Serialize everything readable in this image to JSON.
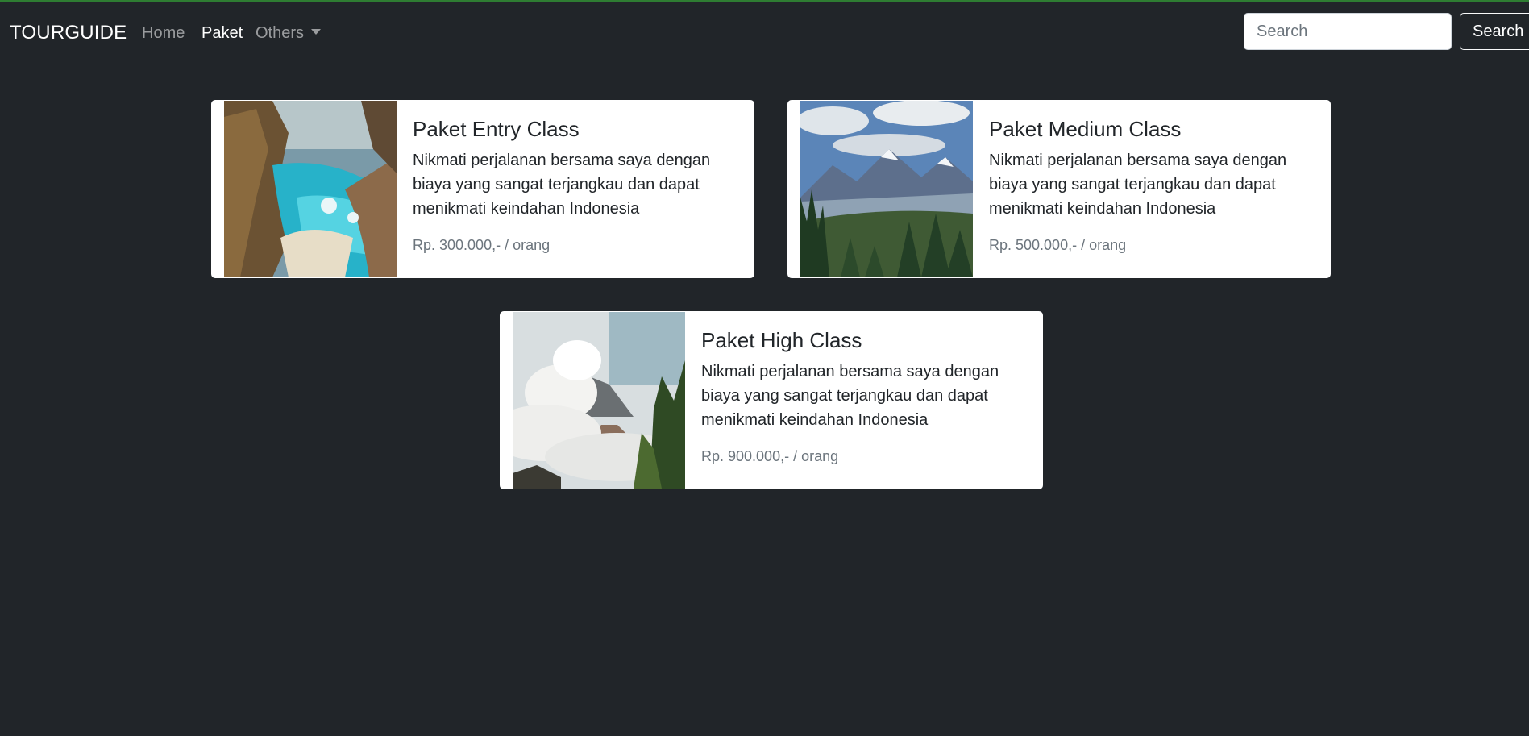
{
  "navbar": {
    "brand": "TOURGUIDE",
    "links": [
      {
        "label": "Home",
        "active": false
      },
      {
        "label": "Paket",
        "active": true
      },
      {
        "label": "Others",
        "active": false,
        "dropdown": true
      }
    ],
    "search": {
      "placeholder": "Search",
      "value": "",
      "button_label": "Search"
    }
  },
  "cards": [
    {
      "title": "Paket Entry Class",
      "description": "Nikmati perjalanan bersama saya dengan biaya yang sangat terjangkau dan dapat menikmati keindahan Indonesia",
      "price": "Rp. 300.000,- / orang",
      "image": "coastal-waterfall-landscape"
    },
    {
      "title": "Paket Medium Class",
      "description": "Nikmati perjalanan bersama saya dengan biaya yang sangat terjangkau dan dapat menikmati keindahan Indonesia",
      "price": "Rp. 500.000,- / orang",
      "image": "mountain-forest-landscape"
    },
    {
      "title": "Paket High Class",
      "description": "Nikmati perjalanan bersama saya dengan biaya yang sangat terjangkau dan dapat menikmati keindahan Indonesia",
      "price": "Rp. 900.000,- / orang",
      "image": "misty-volcano-landscape"
    }
  ],
  "colors": {
    "background": "#212529",
    "card": "#ffffff",
    "price_text": "#6c757d",
    "top_accent": "#2e7d32"
  }
}
